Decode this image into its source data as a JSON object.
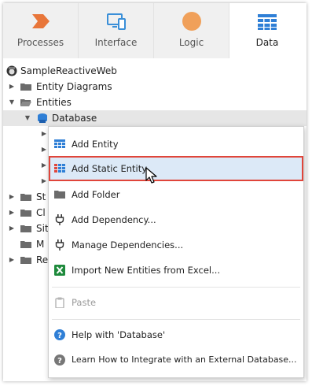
{
  "tabs": [
    {
      "label": "Processes",
      "icon": "processes-icon",
      "color": "#e8763a"
    },
    {
      "label": "Interface",
      "icon": "interface-icon",
      "color": "#3a8fd8"
    },
    {
      "label": "Logic",
      "icon": "logic-icon",
      "color": "#f0a05a"
    },
    {
      "label": "Data",
      "icon": "data-icon",
      "color": "#2f7fd6",
      "active": true
    }
  ],
  "tree": {
    "root_label": "SampleReactiveWeb",
    "entity_diagrams_label": "Entity Diagrams",
    "entities_label": "Entities",
    "database_label": "Database",
    "partial_labels": [
      "St",
      "Cl",
      "Sit",
      "M",
      "Re"
    ]
  },
  "context_menu": {
    "items": [
      {
        "label": "Add Entity",
        "icon": "entity-grid-icon"
      },
      {
        "label": "Add Static Entity",
        "icon": "static-entity-icon",
        "highlighted": true
      },
      {
        "label": "Add Folder",
        "icon": "folder-icon"
      },
      {
        "label": "Add Dependency...",
        "icon": "plug-icon"
      },
      {
        "label": "Manage Dependencies...",
        "icon": "plug-icon"
      },
      {
        "label": "Import New Entities from Excel...",
        "icon": "excel-icon"
      },
      {
        "label": "Paste",
        "icon": "clipboard-icon",
        "disabled": true
      },
      {
        "label": "Help with 'Database'",
        "icon": "help-icon"
      },
      {
        "label": "Learn How to Integrate with an External Database...",
        "icon": "help-icon"
      }
    ]
  },
  "colors": {
    "highlight_border": "#e0453a",
    "highlight_fill": "#dce9f7",
    "accent_blue": "#2f7fd6"
  }
}
